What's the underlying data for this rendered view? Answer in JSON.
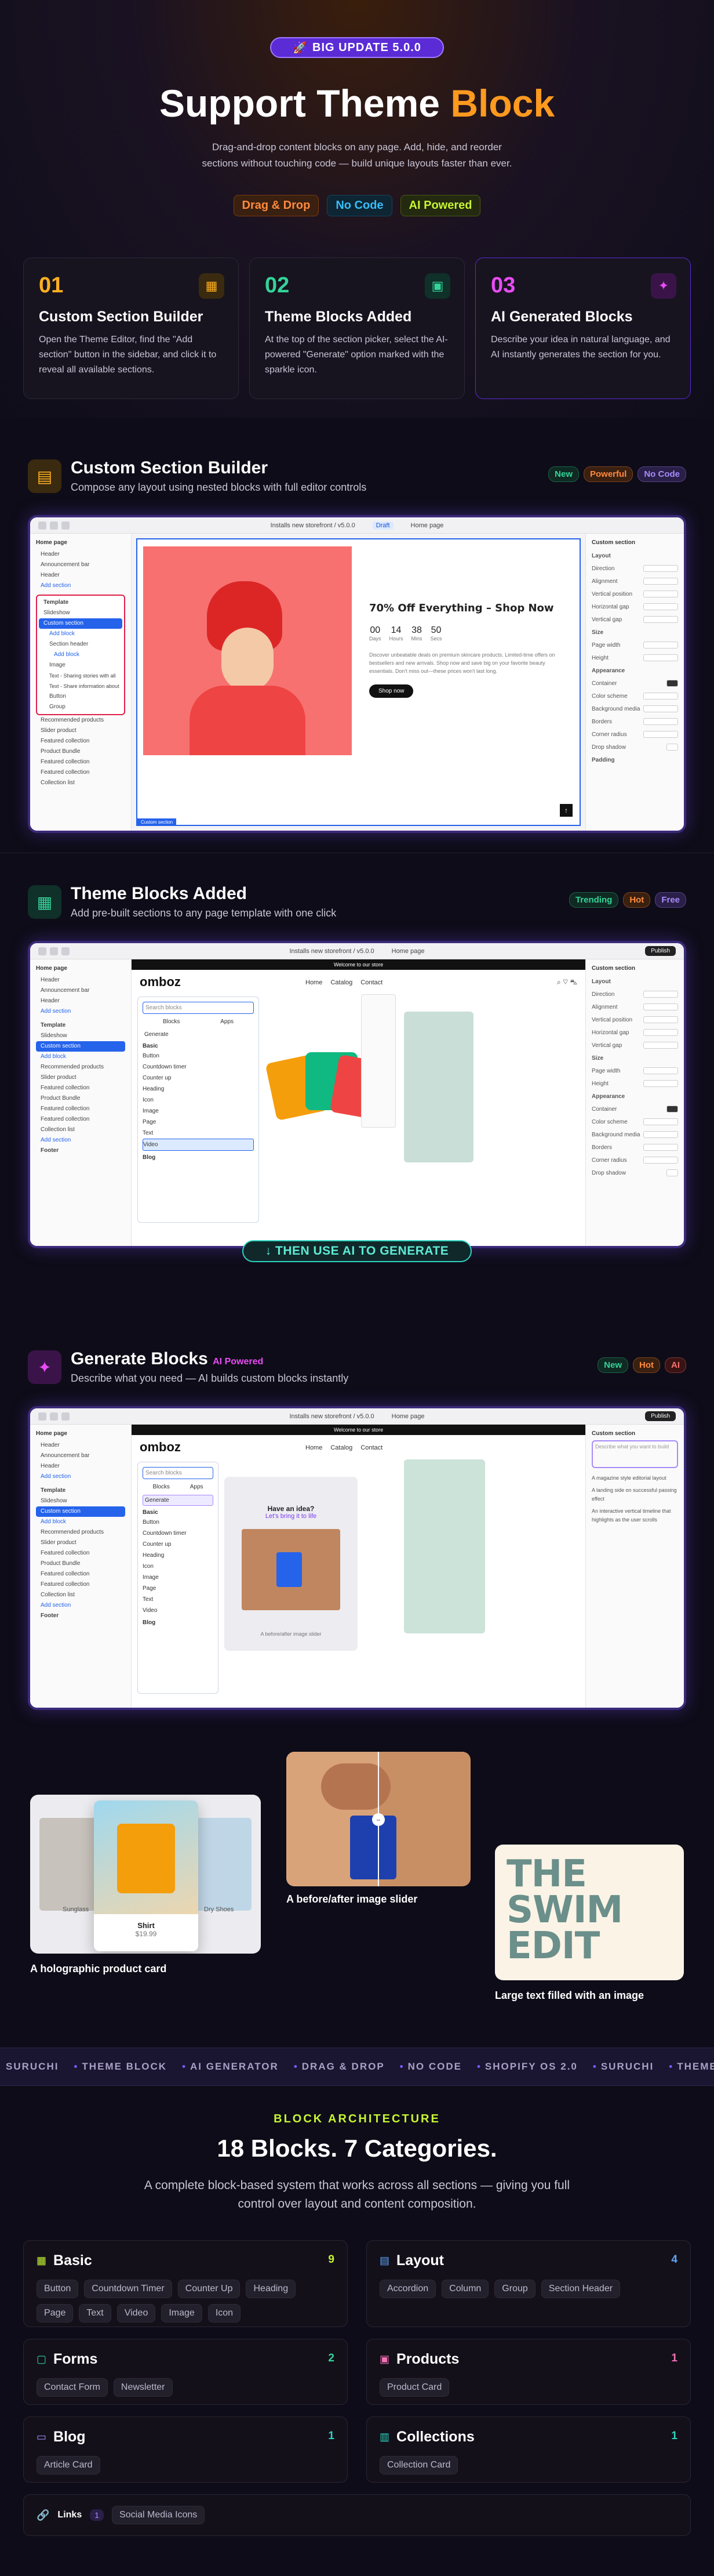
{
  "hero": {
    "badge": "BIG UPDATE 5.0.0",
    "title_main": "Support Theme",
    "title_accent": "Block",
    "desc_line1": "Drag-and-drop content blocks on any page. Add, hide, and reorder",
    "desc_line2": "sections without touching code — build unique layouts faster than ever.",
    "chips": [
      {
        "label": "Drag & Drop",
        "color": "#ff8a3d",
        "bg": "#3a2010",
        "border": "#7a3a10"
      },
      {
        "label": "No Code",
        "color": "#38bdf8",
        "bg": "#0e2533",
        "border": "#144560"
      },
      {
        "label": "AI Powered",
        "color": "#c6f432",
        "bg": "#232a10",
        "border": "#4a5a14"
      }
    ]
  },
  "steps": [
    {
      "num": "01",
      "title": "Custom Section Builder",
      "desc": "Open the Theme Editor, find the \"Add section\" button in the sidebar, and click it to reveal all available sections.",
      "color": "#ffb020",
      "border": "#2c2838"
    },
    {
      "num": "02",
      "title": "Theme Blocks Added",
      "desc": "At the top of the section picker, select the AI-powered \"Generate\" option marked with the sparkle icon.",
      "color": "#34d399",
      "border": "#2c2838"
    },
    {
      "num": "03",
      "title": "AI Generated Blocks",
      "desc": "Describe your idea in natural language, and AI instantly generates the section for you.",
      "color": "#e84cf5",
      "border": "#5b2bd6"
    }
  ],
  "sections": [
    {
      "title": "Custom Section Builder",
      "sub": "Compose any layout using nested blocks with full editor controls",
      "icon": "layout-icon",
      "icon_color": "#ffb020",
      "icon_bg": "#3a2a10",
      "tags": [
        {
          "label": "New",
          "color": "#34d399",
          "bg": "#0f2a22"
        },
        {
          "label": "Powerful",
          "color": "#ff8a3d",
          "bg": "#3a2010"
        },
        {
          "label": "No Code",
          "color": "#a78bfa",
          "bg": "#2a1f48"
        }
      ]
    },
    {
      "title": "Theme Blocks Added",
      "sub": "Add pre-built sections to any page template with one click",
      "icon": "blocks-icon",
      "icon_color": "#34d399",
      "icon_bg": "#10302a",
      "tags": [
        {
          "label": "Trending",
          "color": "#34d399",
          "bg": "#0f2a22"
        },
        {
          "label": "Hot",
          "color": "#ff8a3d",
          "bg": "#3a2010"
        },
        {
          "label": "Free",
          "color": "#a78bfa",
          "bg": "#2a1f48"
        }
      ]
    },
    {
      "title": "Generate Blocks",
      "title_tag": "AI Powered",
      "sub": "Describe what you need — AI builds custom blocks instantly",
      "icon": "sparkle-icon",
      "icon_color": "#e84cf5",
      "icon_bg": "#3a1448",
      "tags": [
        {
          "label": "New",
          "color": "#34d399",
          "bg": "#0f2a22"
        },
        {
          "label": "Hot",
          "color": "#ff8a3d",
          "bg": "#3a2010"
        },
        {
          "label": "AI",
          "color": "#f87171",
          "bg": "#3a1414"
        }
      ]
    }
  ],
  "editor": {
    "url": "Installs new storefront / v5.0.0",
    "page": "Home page",
    "draft": "Draft",
    "publish": "Publish",
    "left_title": "Home page",
    "left_header": "Header",
    "left_items": [
      "Announcement bar",
      "Header",
      "Add section"
    ],
    "left_template": "Template",
    "left_tpl_items": [
      "Slideshow",
      "Custom section",
      "Add block",
      "Section header",
      "Add block",
      "Image",
      "Text - Sharing stories with all",
      "Text - Share information about",
      "Button",
      "Group"
    ],
    "left_more": [
      "Recommended products",
      "Slider product",
      "Featured collection",
      "Product Bundle",
      "Featured collection",
      "Featured collection",
      "Collection list",
      "Add section"
    ],
    "left_footer": "Footer",
    "right_title": "Custom section",
    "right_rows": [
      "Layout",
      "Direction",
      "Alignment",
      "Vertical position",
      "Horizontal gap",
      "Vertical gap",
      "Size",
      "Page width",
      "Height",
      "Appearance",
      "Container",
      "Color scheme",
      "Background media",
      "Borders",
      "Corner radius",
      "Drop shadow",
      "Padding"
    ],
    "promo_title": "70% Off Everything – Shop Now",
    "promo_count": [
      "00",
      "14",
      "38",
      "50"
    ],
    "promo_units": [
      "Days",
      "Hours",
      "Mins",
      "Secs"
    ],
    "promo_desc": "Discover unbeatable deals on premium skincare products. Limited-time offers on bestsellers and new arrivals. Shop now and save big on your favorite beauty essentials. Don't miss out—these prices won't last long.",
    "promo_btn": "Shop now",
    "section_label": "Custom section"
  },
  "store": {
    "announce": "Welcome to our store",
    "brand": "omboz",
    "nav": [
      "Home",
      "Catalog",
      "Contact"
    ],
    "picker_search": "Search blocks",
    "picker_tabs": [
      "Blocks",
      "Apps"
    ],
    "picker_generate": "Generate",
    "picker_basic": "Basic",
    "picker_items": [
      "Button",
      "Countdown timer",
      "Counter up",
      "Heading",
      "Icon",
      "Image",
      "Page",
      "Text",
      "Video"
    ],
    "picker_blog": "Blog",
    "ai_prompt": "Describe what you want to build",
    "ai_suggestions": [
      "A magazine style editorial layout",
      "A landing side on successful passing effect",
      "An interactive vertical timeline that highlights as the user scrolls"
    ],
    "idea_title": "Have an idea?",
    "idea_sub": "Let's bring it to life",
    "idea_cap": "A before/after image slider"
  },
  "features": {
    "f1_caption": "A holographic product card",
    "f1_product": "Shirt",
    "f1_price": "$19.99",
    "f1_left": "Sunglass",
    "f1_right": "Dry Shoes",
    "f2_caption": "A before/after image slider",
    "f3_caption": "Large text filled with an image",
    "f3_text": [
      "THE",
      "SWIM",
      "EDIT"
    ]
  },
  "cta_mid": "↓ THEN USE AI TO GENERATE",
  "marquee": [
    "SURUCHI",
    "THEME BLOCK",
    "AI GENERATOR",
    "DRAG & DROP",
    "NO CODE",
    "SHOPIFY OS 2.0",
    "SURUCHI",
    "THEME BLOCK"
  ],
  "arch": {
    "label": "BLOCK ARCHITECTURE",
    "title": "18 Blocks. 7 Categories.",
    "sub": "A complete block-based system that works across all sections — giving you full control over layout and content composition.",
    "categories": [
      {
        "name": "Basic",
        "count": "9",
        "color": "#c6f432",
        "icon": "grid-icon",
        "items": [
          "Button",
          "Countdown Timer",
          "Counter Up",
          "Heading",
          "Page",
          "Text",
          "Video",
          "Image",
          "Icon"
        ]
      },
      {
        "name": "Layout",
        "count": "4",
        "color": "#60a5fa",
        "icon": "layout-icon",
        "items": [
          "Accordion",
          "Column",
          "Group",
          "Section Header"
        ]
      },
      {
        "name": "Forms",
        "count": "2",
        "color": "#34d399",
        "icon": "form-icon",
        "items": [
          "Contact Form",
          "Newsletter"
        ]
      },
      {
        "name": "Products",
        "count": "1",
        "color": "#f472b6",
        "icon": "bag-icon",
        "items": [
          "Product Card"
        ]
      },
      {
        "name": "Blog",
        "count": "1",
        "color": "#a78bfa",
        "icon": "blog-icon",
        "items": [
          "Article Card"
        ]
      },
      {
        "name": "Collections",
        "count": "1",
        "color": "#2dd4bf",
        "icon": "collection-icon",
        "items": [
          "Collection Card"
        ]
      },
      {
        "name": "Links",
        "count": "1",
        "color": "#a78bfa",
        "icon": "link-icon",
        "items": [
          "Social Media Icons"
        ]
      }
    ]
  }
}
